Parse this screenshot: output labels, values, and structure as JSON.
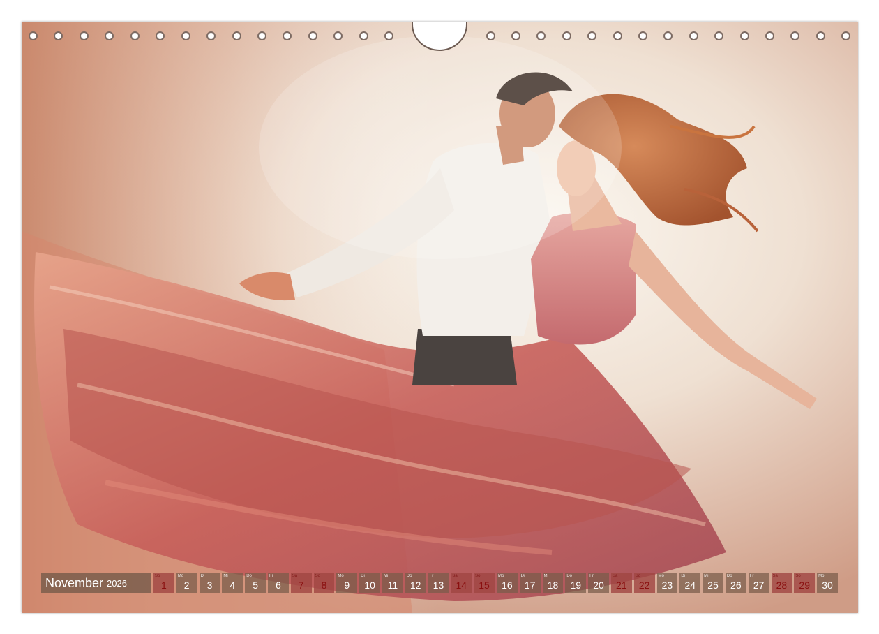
{
  "calendar": {
    "month": "November",
    "year": "2026",
    "days": [
      {
        "dn": "So",
        "d": "1",
        "weekend": true
      },
      {
        "dn": "Mo",
        "d": "2",
        "weekend": false
      },
      {
        "dn": "Di",
        "d": "3",
        "weekend": false
      },
      {
        "dn": "Mi",
        "d": "4",
        "weekend": false
      },
      {
        "dn": "Do",
        "d": "5",
        "weekend": false
      },
      {
        "dn": "Fr",
        "d": "6",
        "weekend": false
      },
      {
        "dn": "Sa",
        "d": "7",
        "weekend": true
      },
      {
        "dn": "So",
        "d": "8",
        "weekend": true
      },
      {
        "dn": "Mo",
        "d": "9",
        "weekend": false
      },
      {
        "dn": "Di",
        "d": "10",
        "weekend": false
      },
      {
        "dn": "Mi",
        "d": "11",
        "weekend": false
      },
      {
        "dn": "Do",
        "d": "12",
        "weekend": false
      },
      {
        "dn": "Fr",
        "d": "13",
        "weekend": false
      },
      {
        "dn": "Sa",
        "d": "14",
        "weekend": true
      },
      {
        "dn": "So",
        "d": "15",
        "weekend": true
      },
      {
        "dn": "Mo",
        "d": "16",
        "weekend": false
      },
      {
        "dn": "Di",
        "d": "17",
        "weekend": false
      },
      {
        "dn": "Mi",
        "d": "18",
        "weekend": false
      },
      {
        "dn": "Do",
        "d": "19",
        "weekend": false
      },
      {
        "dn": "Fr",
        "d": "20",
        "weekend": false
      },
      {
        "dn": "Sa",
        "d": "21",
        "weekend": true
      },
      {
        "dn": "So",
        "d": "22",
        "weekend": true
      },
      {
        "dn": "Mo",
        "d": "23",
        "weekend": false
      },
      {
        "dn": "Di",
        "d": "24",
        "weekend": false
      },
      {
        "dn": "Mi",
        "d": "25",
        "weekend": false
      },
      {
        "dn": "Do",
        "d": "26",
        "weekend": false
      },
      {
        "dn": "Fr",
        "d": "27",
        "weekend": false
      },
      {
        "dn": "Sa",
        "d": "28",
        "weekend": true
      },
      {
        "dn": "So",
        "d": "29",
        "weekend": true
      },
      {
        "dn": "Mo",
        "d": "30",
        "weekend": false
      }
    ]
  },
  "colors": {
    "bar": "#785c4a",
    "weekend_text": "#8a0f0f",
    "dress": "#c86a6a",
    "background_light": "#f3ece4"
  }
}
